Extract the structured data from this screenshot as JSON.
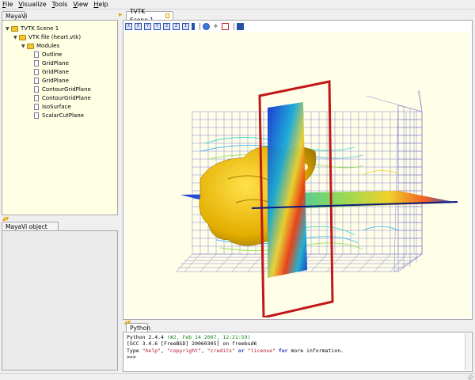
{
  "menu": [
    {
      "first": "F",
      "rest": "ile"
    },
    {
      "first": "V",
      "rest": "isualize"
    },
    {
      "first": "T",
      "rest": "ools"
    },
    {
      "first": "V",
      "rest": "iew"
    },
    {
      "first": "H",
      "rest": "elp"
    }
  ],
  "tree_panel": {
    "tab_label": "MayaVi",
    "nodes": [
      {
        "label": "TVTK Scene 1",
        "icon": "folder-icon",
        "expanded": true,
        "depth": 0
      },
      {
        "label": "VTK file (heart.vtk)",
        "icon": "folder-icon",
        "expanded": true,
        "depth": 1
      },
      {
        "label": "Modules",
        "icon": "folder-icon",
        "expanded": true,
        "depth": 2
      },
      {
        "label": "Outline",
        "icon": "document-icon",
        "depth": 3
      },
      {
        "label": "GridPlane",
        "icon": "document-icon",
        "depth": 3
      },
      {
        "label": "GridPlane",
        "icon": "document-icon",
        "depth": 3
      },
      {
        "label": "GridPlane",
        "icon": "document-icon",
        "depth": 3
      },
      {
        "label": "ContourGridPlane",
        "icon": "document-icon",
        "depth": 3
      },
      {
        "label": "ContourGridPlane",
        "icon": "document-icon",
        "depth": 3
      },
      {
        "label": "IsoSurface",
        "icon": "document-icon",
        "depth": 3
      },
      {
        "label": "ScalarCutPlane",
        "icon": "document-icon",
        "depth": 3
      }
    ]
  },
  "editor_panel": {
    "tab_label": "MayaVi object editor"
  },
  "scene_panel": {
    "tab_label": "TVTK Scene 1",
    "toolbar": [
      "view-x-positive-icon",
      "view-x-negative-icon",
      "view-y-positive-icon",
      "view-y-negative-icon",
      "view-z-positive-icon",
      "view-z-negative-icon",
      "isometric-view-icon",
      "parallel-projection-icon",
      "axes-icon",
      "fullscreen-icon",
      "save-icon"
    ],
    "toolbar_glyphs": [
      "X",
      "X",
      "Y",
      "Y",
      "Z",
      "Z",
      "I",
      "",
      "",
      "",
      ""
    ]
  },
  "python_panel": {
    "tab_label": "Python",
    "lines": [
      {
        "text": "Python 2.4.4 ",
        "green": "(#2, Feb 14 2007, 12:21:59)"
      },
      {
        "text": "[GCC 3.4.6 [FreeBSD] 20060305] on freebsd6"
      },
      {
        "p1": "Type ",
        "s1": "\"help\"",
        "p2": ", ",
        "s2": "\"copyright\"",
        "p3": ", ",
        "s3": "\"credits\"",
        "p4": " ",
        "k1": "or",
        "p5": " ",
        "s4": "\"license\"",
        "p6": " ",
        "k2": "for",
        "p7": " more information."
      },
      {
        "text": ">>> "
      }
    ]
  },
  "colors": {
    "background": "#efefef",
    "tree_background": "#ffffe4",
    "viewport_background": "#fffee8",
    "outline_red": "#c01818",
    "grid_line": "#6a6ac8",
    "isosurface": "#e8b800",
    "accent": "#e6a600"
  }
}
